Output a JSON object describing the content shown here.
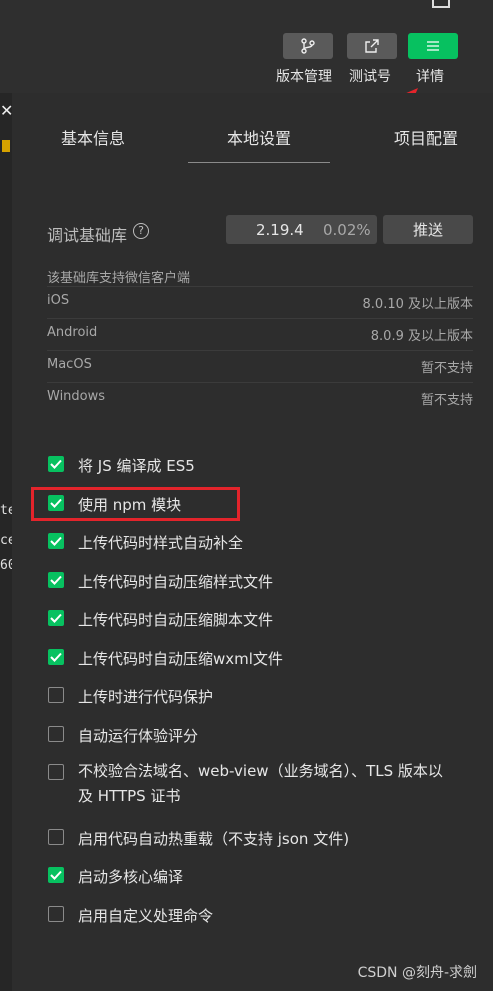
{
  "toolbar": {
    "buttons": [
      {
        "icon": "branch-icon",
        "label": "版本管理",
        "color": "#5a5a5a"
      },
      {
        "icon": "external-link-icon",
        "label": "测试号",
        "color": "#5a5a5a"
      },
      {
        "icon": "menu-icon",
        "label": "详情",
        "color": "#07c160"
      }
    ]
  },
  "left_fragments": [
    "te",
    "ce",
    "60"
  ],
  "tabs": [
    "基本信息",
    "本地设置",
    "项目配置"
  ],
  "active_tab": "本地设置",
  "base_lib": {
    "label": "调试基础库",
    "version": "2.19.4",
    "percent": "0.02%",
    "push_label": "推送",
    "support_note": "该基础库支持微信客户端",
    "platforms": [
      {
        "name": "iOS",
        "value": "8.0.10 及以上版本"
      },
      {
        "name": "Android",
        "value": "8.0.9 及以上版本"
      },
      {
        "name": "MacOS",
        "value": "暂不支持"
      },
      {
        "name": "Windows",
        "value": "暂不支持"
      }
    ]
  },
  "options": [
    {
      "label": "将 JS 编译成 ES5",
      "checked": true
    },
    {
      "label": "使用 npm 模块",
      "checked": true
    },
    {
      "label": "上传代码时样式自动补全",
      "checked": true
    },
    {
      "label": "上传代码时自动压缩样式文件",
      "checked": true
    },
    {
      "label": "上传代码时自动压缩脚本文件",
      "checked": true
    },
    {
      "label": "上传代码时自动压缩wxml文件",
      "checked": true
    },
    {
      "label": "上传时进行代码保护",
      "checked": false
    },
    {
      "label": "自动运行体验评分",
      "checked": false
    },
    {
      "label": "不校验合法域名、web-view（业务域名）、TLS 版本以及 HTTPS 证书",
      "checked": false
    },
    {
      "label": "启用代码自动热重载（不支持 json 文件)",
      "checked": false
    },
    {
      "label": "启动多核心编译",
      "checked": true
    },
    {
      "label": "启用自定义处理命令",
      "checked": false
    }
  ],
  "footer": "CSDN @刻舟-求劍",
  "colors": {
    "accent": "#07c160",
    "highlight": "#e3242b",
    "background": "#2d2d2d"
  }
}
